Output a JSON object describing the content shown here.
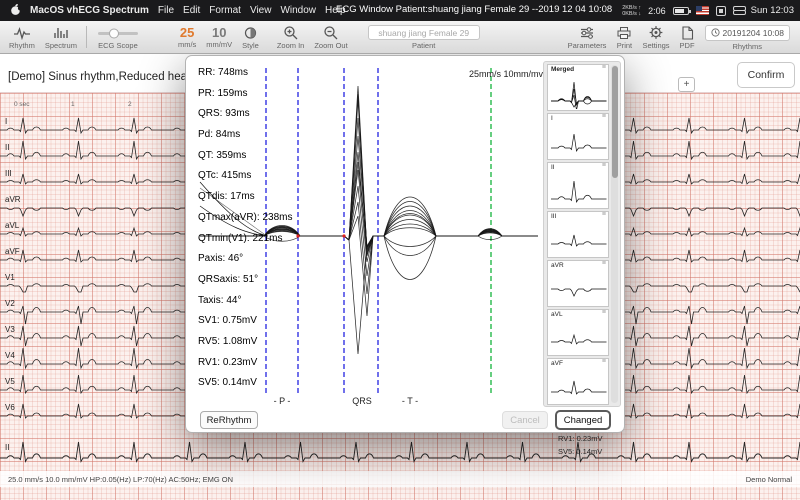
{
  "menubar": {
    "app_name": "MacOS vhECG Spectrum",
    "menus": [
      "File",
      "Edit",
      "Format",
      "View",
      "Window",
      "Help"
    ],
    "window_title": "ECG Window Patient:shuang jiang Female 29 --2019 12 04 10:08",
    "status": {
      "net_up": "2KB/s ↑",
      "net_down": "0KB/s ↓",
      "battery_time": "2:06",
      "clock": "Sun 12:03"
    }
  },
  "toolbar": {
    "rhythm": "Rhythm",
    "spectrum": "Spectrum",
    "ecg_scope": "ECG Scope",
    "speed_value": "25",
    "speed_unit": "mm/s",
    "gain_value": "10",
    "gain_unit": "mm/mV",
    "style": "Style",
    "zoom_in": "Zoom In",
    "zoom_out": "Zoom Out",
    "patient_value": "shuang jiang Female 29",
    "patient_label": "Patient",
    "parameters": "Parameters",
    "print": "Print",
    "settings": "Settings",
    "pdf": "PDF",
    "rhythms_value": "20191204 10:08",
    "rhythms_label": "Rhythms"
  },
  "info_bar": {
    "diagnosis": "[Demo] Sinus rhythm,Reduced heart rate va",
    "add_button": "+",
    "confirm": "Confirm"
  },
  "ecg": {
    "timeline": [
      "0 sec",
      "1",
      "2"
    ],
    "leads": [
      "I",
      "II",
      "III",
      "aVR",
      "aVL",
      "aVF",
      "V1",
      "V2",
      "V3",
      "V4",
      "V5",
      "V6"
    ],
    "rhythm_lead": "II",
    "partial_measurements": [
      "RV1: 0.23mV",
      "SV5: 0.14mV"
    ]
  },
  "dialog": {
    "scale": "25mm/s 10mm/mv",
    "measurements": [
      "RR: 748ms",
      "PR: 159ms",
      "QRS: 93ms",
      "Pd: 84ms",
      "QT: 359ms",
      "QTc: 415ms",
      "QTdis: 17ms",
      "QTmax(aVR): 238ms",
      "QTmin(V1): 221ms",
      "Paxis: 46°",
      "QRSaxis: 51°",
      "Taxis: 44°",
      "SV1: 0.75mV",
      "RV5: 1.08mV",
      "RV1: 0.23mV",
      "SV5: 0.14mV"
    ],
    "markers": {
      "p": "- P -",
      "qrs": "QRS",
      "t": "- T -"
    },
    "buttons": {
      "rerhythm": "ReRhythm",
      "cancel": "Cancel",
      "changed": "Changed"
    },
    "thumbnails": [
      "Merged",
      "I",
      "II",
      "III",
      "aVR",
      "aVL",
      "aVF"
    ]
  },
  "status_bar": {
    "left": "25.0 mm/s   10.0 mm/mV   HP:0.05(Hz)   LP:70(Hz)   AC:50Hz;   EMG ON",
    "right": "Demo Normal"
  }
}
